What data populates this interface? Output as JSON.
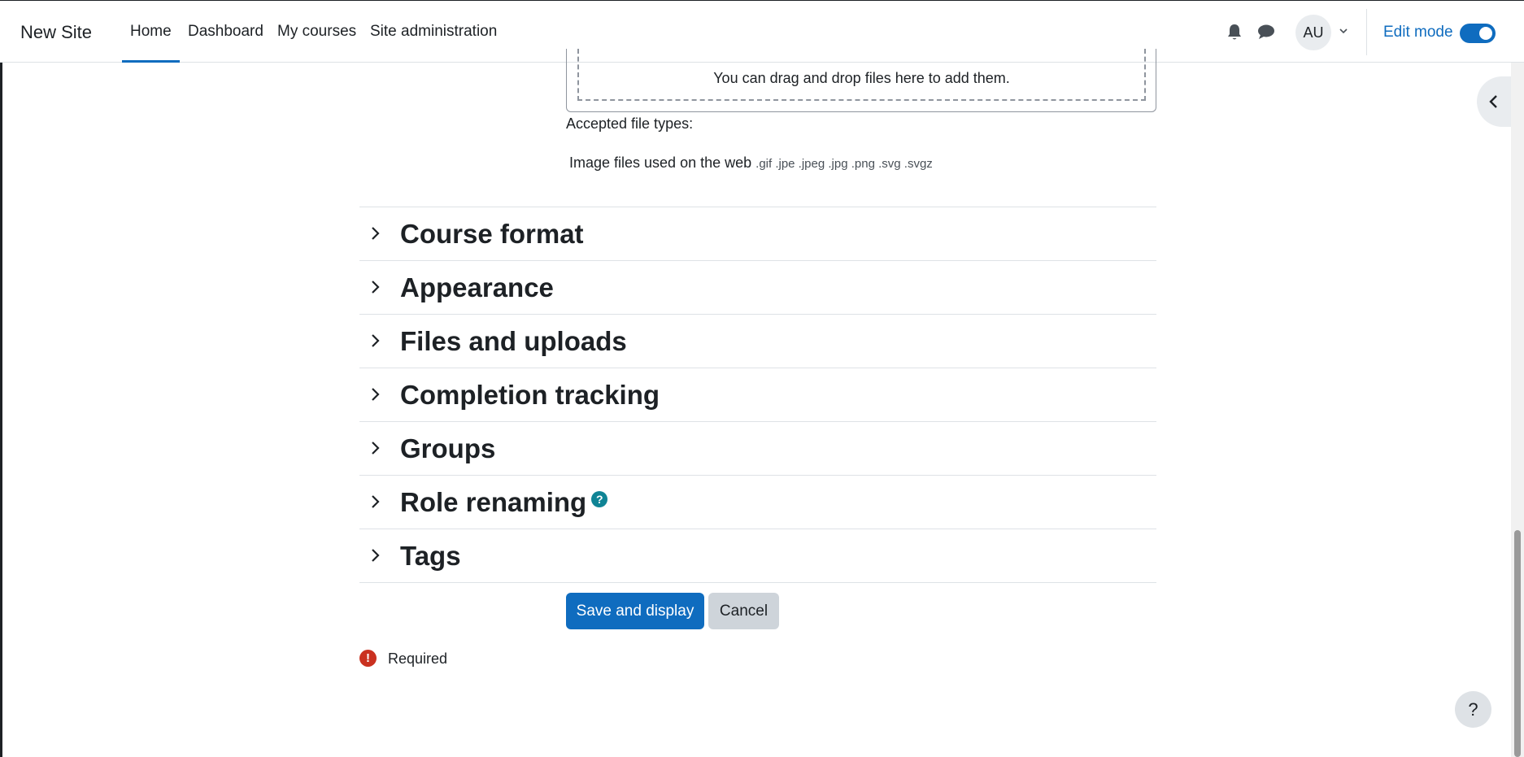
{
  "navbar": {
    "brand": "New Site",
    "items": [
      {
        "label": "Home",
        "active": true
      },
      {
        "label": "Dashboard"
      },
      {
        "label": "My courses"
      },
      {
        "label": "Site administration"
      }
    ],
    "notification_icon": "bell-icon",
    "messages_icon": "chat-icon",
    "user_initials": "AU",
    "edit_mode_label": "Edit mode",
    "edit_mode_on": true
  },
  "filepicker": {
    "drop_text": "You can drag and drop files here to add them.",
    "accepted_label": "Accepted file types:",
    "accepted_desc": "Image files used on the web",
    "accepted_ext": ".gif .jpe .jpeg .jpg .png .svg .svgz"
  },
  "sections": [
    {
      "title": "Course format"
    },
    {
      "title": "Appearance"
    },
    {
      "title": "Files and uploads"
    },
    {
      "title": "Completion tracking"
    },
    {
      "title": "Groups"
    },
    {
      "title": "Role renaming",
      "help": "?"
    },
    {
      "title": "Tags"
    }
  ],
  "actions": {
    "save_label": "Save and display",
    "cancel_label": "Cancel"
  },
  "required": {
    "icon": "!",
    "label": "Required"
  },
  "help_button": "?",
  "colors": {
    "primary": "#0f6cbf",
    "danger": "#ca3120",
    "info": "#0f8495"
  }
}
